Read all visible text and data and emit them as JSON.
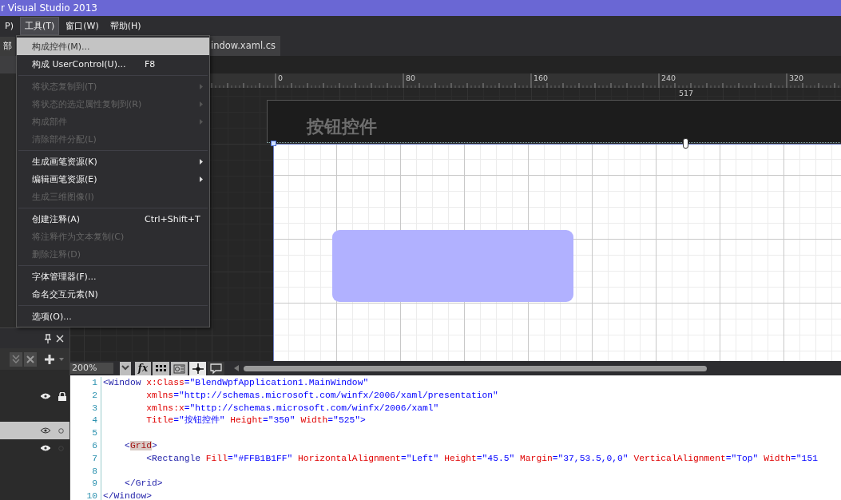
{
  "window": {
    "title": "r Visual Studio 2013"
  },
  "menu_bar": [
    {
      "label": "P)",
      "selected": false
    },
    {
      "label": "工具(T)",
      "selected": true
    },
    {
      "label": "窗口(W)",
      "selected": false
    },
    {
      "label": "帮助(H)",
      "selected": false
    }
  ],
  "tools_menu": [
    {
      "kind": "item",
      "label": "构成控件(M)...",
      "selected": true,
      "disabled": false,
      "submenu": false
    },
    {
      "kind": "item",
      "label": "构成 UserControl(U)...",
      "shortcut": "F8",
      "selected": false,
      "disabled": false,
      "submenu": false
    },
    {
      "kind": "separator"
    },
    {
      "kind": "item",
      "label": "将状态复制到(T)",
      "selected": false,
      "disabled": true,
      "submenu": true
    },
    {
      "kind": "item",
      "label": "将状态的选定属性复制到(R)",
      "selected": false,
      "disabled": true,
      "submenu": true
    },
    {
      "kind": "item",
      "label": "构成部件",
      "selected": false,
      "disabled": true,
      "submenu": true
    },
    {
      "kind": "item",
      "label": "清除部件分配(L)",
      "selected": false,
      "disabled": true,
      "submenu": false
    },
    {
      "kind": "separator"
    },
    {
      "kind": "item",
      "label": "生成画笔资源(K)",
      "selected": false,
      "disabled": false,
      "submenu": true
    },
    {
      "kind": "item",
      "label": "编辑画笔资源(E)",
      "selected": false,
      "disabled": false,
      "submenu": true
    },
    {
      "kind": "item",
      "label": "生成三维图像(I)",
      "selected": false,
      "disabled": true,
      "submenu": false
    },
    {
      "kind": "separator"
    },
    {
      "kind": "item",
      "label": "创建注释(A)",
      "shortcut": "Ctrl+Shift+T",
      "selected": false,
      "disabled": false,
      "submenu": false
    },
    {
      "kind": "item",
      "label": "将注释作为文本复制(C)",
      "selected": false,
      "disabled": true,
      "submenu": false
    },
    {
      "kind": "item",
      "label": "删除注释(D)",
      "selected": false,
      "disabled": true,
      "submenu": false
    },
    {
      "kind": "separator"
    },
    {
      "kind": "item",
      "label": "字体管理器(F)...",
      "selected": false,
      "disabled": false,
      "submenu": false
    },
    {
      "kind": "item",
      "label": "命名交互元素(N)",
      "selected": false,
      "disabled": false,
      "submenu": false
    },
    {
      "kind": "separator"
    },
    {
      "kind": "item",
      "label": "选项(O)...",
      "selected": false,
      "disabled": false,
      "submenu": false
    }
  ],
  "left_panel": {
    "tab": "部",
    "layers": [
      {
        "selected": false,
        "locked": true
      },
      {
        "selected": true,
        "locked": false
      },
      {
        "selected": false,
        "locked": false
      }
    ]
  },
  "document_tab": {
    "label": "indow.xaml.cs",
    "selected": true
  },
  "designer": {
    "ruler_labels": [
      "0",
      "80",
      "160",
      "240",
      "320"
    ],
    "measurement": "517",
    "window_title": "按钮控件"
  },
  "toolbar": {
    "zoom": "200%",
    "buttons": [
      {
        "kind": "dropdown",
        "selected": false
      },
      {
        "kind": "fx",
        "label": "fx",
        "selected": false
      },
      {
        "kind": "grid",
        "selected": false
      },
      {
        "kind": "effects",
        "selected": false
      },
      {
        "kind": "snap",
        "selected": true
      },
      {
        "kind": "annotation",
        "selected": false
      }
    ]
  },
  "code_lines": [
    {
      "number": "1",
      "tokens": [
        {
          "kind": "tag",
          "text": "<Window "
        },
        {
          "kind": "attr",
          "text": "x:Class"
        },
        {
          "kind": "value",
          "text": "=\"BlendWpfApplication1.MainWindow\""
        }
      ]
    },
    {
      "number": "2",
      "tokens": [
        {
          "kind": "attr",
          "text": "        xmlns"
        },
        {
          "kind": "value",
          "text": "=\"http://schemas.microsoft.com/winfx/2006/xaml/presentation\""
        }
      ]
    },
    {
      "number": "3",
      "tokens": [
        {
          "kind": "attr",
          "text": "        xmlns:x"
        },
        {
          "kind": "value",
          "text": "=\"http://schemas.microsoft.com/winfx/2006/xaml\""
        }
      ]
    },
    {
      "number": "4",
      "tokens": [
        {
          "kind": "attr",
          "text": "        Title"
        },
        {
          "kind": "value",
          "text": "=\"按钮控件\" "
        },
        {
          "kind": "attr",
          "text": "Height"
        },
        {
          "kind": "value",
          "text": "=\"350\" "
        },
        {
          "kind": "attr",
          "text": "Width"
        },
        {
          "kind": "value",
          "text": "=\"525\">"
        }
      ]
    },
    {
      "number": "5"
    },
    {
      "number": "6",
      "tokens": [
        {
          "kind": "tag",
          "text": "    <"
        },
        {
          "kind": "mark",
          "text": "Grid"
        },
        {
          "kind": "tag",
          "text": ">"
        }
      ]
    },
    {
      "number": "7",
      "tokens": [
        {
          "kind": "tag",
          "text": "        <Rectangle "
        },
        {
          "kind": "attr",
          "text": "Fill"
        },
        {
          "kind": "value",
          "text": "=\"#FFB1B1FF\" "
        },
        {
          "kind": "attr",
          "text": "HorizontalAlignment"
        },
        {
          "kind": "value",
          "text": "=\"Left\" "
        },
        {
          "kind": "attr",
          "text": "Height"
        },
        {
          "kind": "value",
          "text": "=\"45.5\" "
        },
        {
          "kind": "attr",
          "text": "Margin"
        },
        {
          "kind": "value",
          "text": "=\"37,53.5,0,0\" "
        },
        {
          "kind": "attr",
          "text": "VerticalAlignment"
        },
        {
          "kind": "value",
          "text": "=\"Top\" "
        },
        {
          "kind": "attr",
          "text": "Width"
        },
        {
          "kind": "value",
          "text": "=\"151"
        }
      ]
    },
    {
      "number": "8"
    },
    {
      "number": "9",
      "tokens": [
        {
          "kind": "tag",
          "text": "    </Grid>"
        }
      ]
    },
    {
      "number": "10",
      "tokens": [
        {
          "kind": "tag",
          "text": "</Window>"
        }
      ]
    }
  ]
}
